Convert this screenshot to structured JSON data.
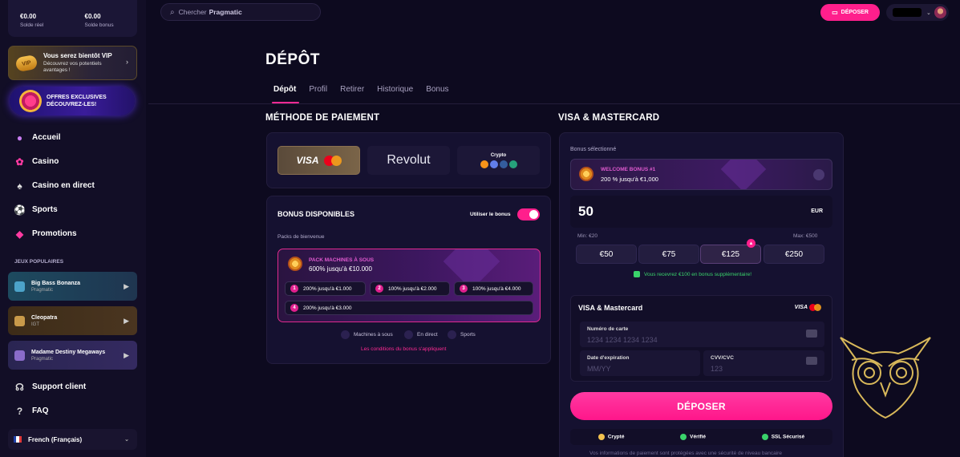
{
  "sidebar": {
    "balance_real_value": "€0.00",
    "balance_real_label": "Solde réel",
    "balance_bonus_value": "€0.00",
    "balance_bonus_label": "Solde bonus",
    "vip_badge": "VIP",
    "vip_title": "Vous serez bientôt VIP",
    "vip_subtitle": "Découvrez vos potentiels avantages !",
    "offer_text": "OFFRES EXCLUSIVES DÉCOUVREZ-LES!",
    "nav": [
      {
        "label": "Accueil"
      },
      {
        "label": "Casino"
      },
      {
        "label": "Casino en direct"
      },
      {
        "label": "Sports"
      },
      {
        "label": "Promotions"
      }
    ],
    "popular_title": "JEUX POPULAIRES",
    "games": [
      {
        "name": "Big Bass Bonanza",
        "provider": "Pragmatic"
      },
      {
        "name": "Cleopatra",
        "provider": "IGT"
      },
      {
        "name": "Madame Destiny Megaways",
        "provider": "Pragmatic"
      }
    ],
    "support": "Support client",
    "faq": "FAQ",
    "language": "French (Français)"
  },
  "topbar": {
    "search_placeholder": "Chercher",
    "search_value": "Pragmatic",
    "deposit_label": "DÉPOSER"
  },
  "main": {
    "title": "DÉPÔT",
    "tabs": [
      {
        "label": "Dépôt",
        "active": true
      },
      {
        "label": "Profil"
      },
      {
        "label": "Retirer"
      },
      {
        "label": "Historique"
      },
      {
        "label": "Bonus"
      }
    ]
  },
  "payment": {
    "heading": "MÉTHODE DE PAIEMENT",
    "methods": [
      {
        "label": "VISA",
        "selected": true
      },
      {
        "label": "Revolut"
      },
      {
        "label": "Crypto"
      }
    ],
    "bonus_heading": "BONUS DISPONIBLES",
    "use_bonus_label": "Utiliser le bonus",
    "use_bonus_on": true,
    "packs_label": "Packs de bienvenue",
    "pack_title": "PACK MACHINES À SOUS",
    "pack_subtitle": "600% jusqu'à €10.000",
    "steps": [
      {
        "n": "1",
        "text": "200% jusqu'à €1.000"
      },
      {
        "n": "2",
        "text": "100% jusqu'à €2.000"
      },
      {
        "n": "3",
        "text": "100% jusqu'à €4.000"
      },
      {
        "n": "4",
        "text": "200% jusqu'à €3.000"
      }
    ],
    "categories": [
      "Machines à sous",
      "En direct",
      "Sports"
    ],
    "conditions_link": "Les conditions du bonus s'appliquent"
  },
  "visa": {
    "heading": "VISA & MASTERCARD",
    "bonus_selected_label": "Bonus sélectionné",
    "welcome_title": "WELCOME BONUS #1",
    "welcome_subtitle": "200 % jusqu'à €1,000",
    "amount": "50",
    "currency": "EUR",
    "min": "Min: €20",
    "max": "Max: €500",
    "quick_amounts": [
      "€50",
      "€75",
      "€125",
      "€250"
    ],
    "bonus_note": "Vous recevrez €100 en bonus supplémentaire!",
    "card_title": "VISA & Mastercard",
    "card_brand": "VISA",
    "card_number_label": "Numéro de carte",
    "card_number_placeholder": "1234 1234 1234 1234",
    "expiry_label": "Date d'expiration",
    "expiry_placeholder": "MM/YY",
    "cvv_label": "CVV/CVC",
    "cvv_placeholder": "123",
    "deposit_button": "DÉPOSER",
    "trust": [
      "Crypté",
      "Vérifié",
      "SSL Sécurisé"
    ],
    "footnote": "Vos informations de paiement sont protégées avec une sécurité de niveau bancaire"
  },
  "colors": {
    "accent": "#ff1f8c",
    "bg": "#0d0a1f",
    "panel": "#151130"
  }
}
